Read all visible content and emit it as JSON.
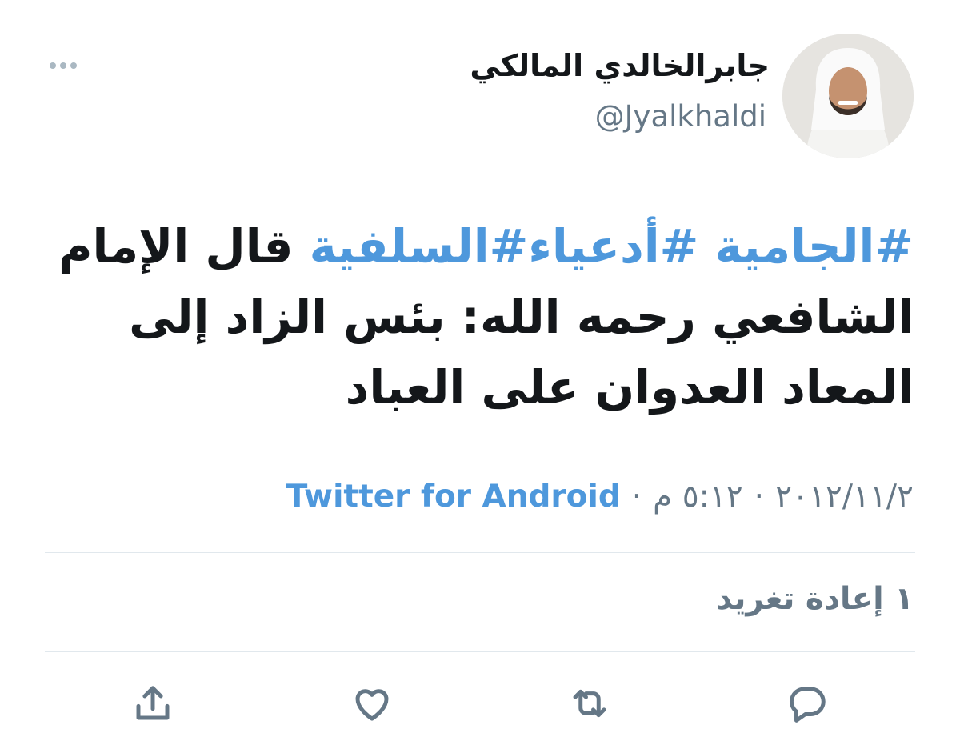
{
  "tweet": {
    "author_name": "جابرالخالدي المالكي",
    "handle": "@Jyalkhaldi",
    "text_parts": [
      {
        "text": "#الجامية",
        "type": "hashtag"
      },
      {
        "text": " ",
        "type": "text"
      },
      {
        "text": "#أدعياء",
        "type": "hashtag"
      },
      {
        "text": "#السلفية",
        "type": "hashtag"
      },
      {
        "text": " قال الإمام الشافعي رحمه الله: بئس الزاد إلى المعاد العدوان على العباد",
        "type": "text"
      }
    ],
    "date": "٢٠١٢/١١/٢",
    "time": "٥:١٢ م",
    "separator": "·",
    "source": "Twitter for Android",
    "retweet_count_label": "١ إعادة تغريد"
  },
  "icons": {
    "more": "more-horizontal-icon",
    "reply": "reply-icon",
    "retweet": "retweet-icon",
    "like": "heart-icon",
    "share": "share-icon"
  },
  "colors": {
    "accent": "#4e98dc",
    "secondary_text": "#657786",
    "primary_text": "#14171a",
    "divider": "#e1e8ed"
  }
}
